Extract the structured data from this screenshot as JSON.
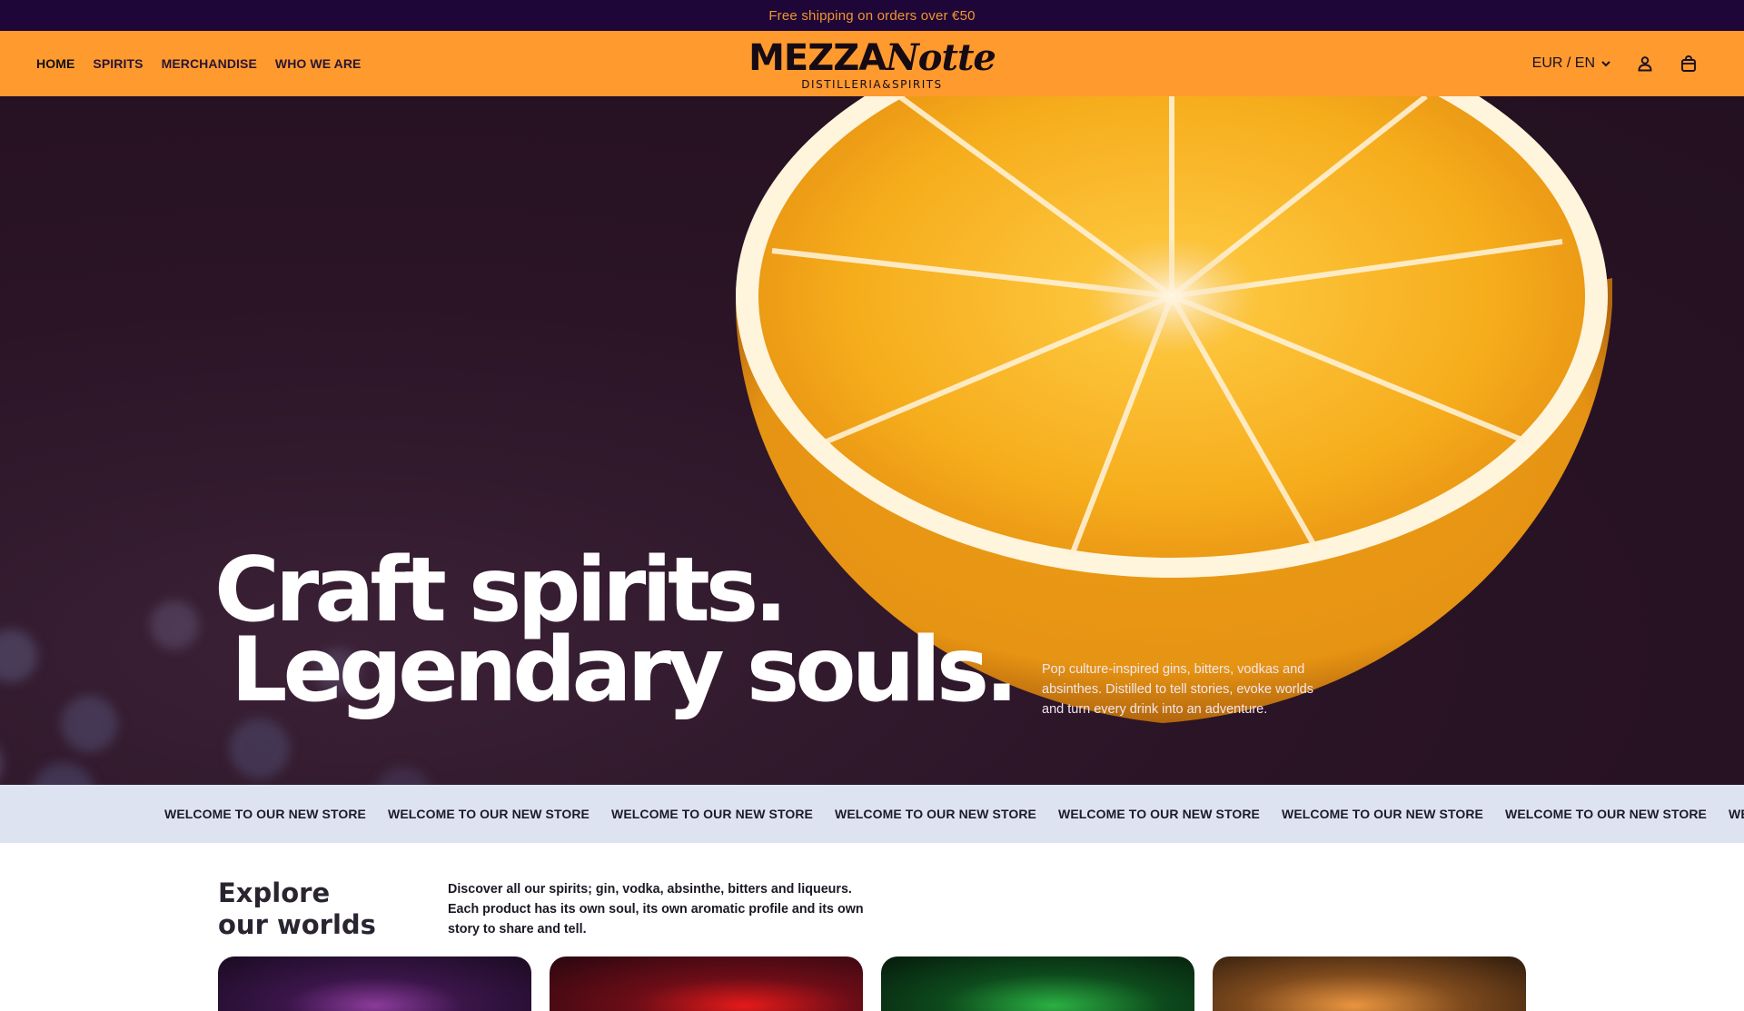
{
  "announcement": {
    "text": "Free shipping on orders over €50"
  },
  "nav": {
    "items": [
      {
        "label": "HOME",
        "active": true
      },
      {
        "label": "SPIRITS",
        "active": false
      },
      {
        "label": "MERCHANDISE",
        "active": false
      },
      {
        "label": "WHO WE ARE",
        "active": false
      }
    ]
  },
  "brand": {
    "name_main": "MEZZA",
    "name_script": "Notte",
    "tagline": "DISTILLERIA&SPIRITS"
  },
  "header_right": {
    "currency_locale": "EUR / EN",
    "account_icon": "user-icon",
    "cart_icon": "bag-icon"
  },
  "hero": {
    "title_line1": "Craft spirits.",
    "title_line2": "Legendary souls.",
    "description": "Pop culture-inspired gins, bitters, vodkas and absinthes. Distilled to tell stories, evoke worlds and turn every drink into an adventure."
  },
  "marquee": {
    "items": [
      "WELCOME TO OUR NEW STORE",
      "WELCOME TO OUR NEW STORE",
      "WELCOME TO OUR NEW STORE",
      "WELCOME TO OUR NEW STORE",
      "WELCOME TO OUR NEW STORE",
      "WELCOME TO OUR NEW STORE",
      "WELCOME TO OUR NEW STORE",
      "WELCOME TO OUR NEW STORE"
    ]
  },
  "explore": {
    "title_line1": "Explore",
    "title_line2": "our worlds",
    "description": "Discover all our spirits; gin, vodka, absinthe, bitters and liqueurs. Each product has its own soul, its own aromatic profile and its own story to share and tell."
  },
  "colors": {
    "announcement_bg": "#1e0639",
    "announcement_text": "#f0962e",
    "header_bg": "#ff9a2f",
    "hero_bg": "#2a1426",
    "marquee_bg": "#dee3f2"
  }
}
